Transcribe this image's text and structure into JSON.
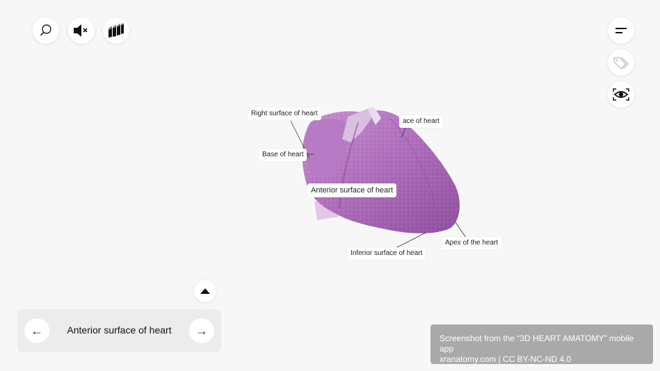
{
  "toolbar": {
    "left_icons": [
      "search-icon",
      "mute-icon",
      "layers-icon"
    ],
    "right_icons": [
      "menu-icon",
      "tag-icon",
      "eye-icon"
    ]
  },
  "model": {
    "labels": {
      "right_surface": "Right surface of heart",
      "left_surface_partial": "ace of heart",
      "base": "Base of heart",
      "anterior_surface": "Anterior surface of heart",
      "apex": "Apex of the heart",
      "inferior_surface": "Inferior surface of heart"
    }
  },
  "navigator": {
    "title": "Anterior surface of heart",
    "prev_icon": "←",
    "next_icon": "→"
  },
  "credit": {
    "line1": "Screenshot from the “3D HEART AMATOMY” mobile app",
    "line2": "xranatomy.com | CC BY-NC-ND 4.0"
  }
}
